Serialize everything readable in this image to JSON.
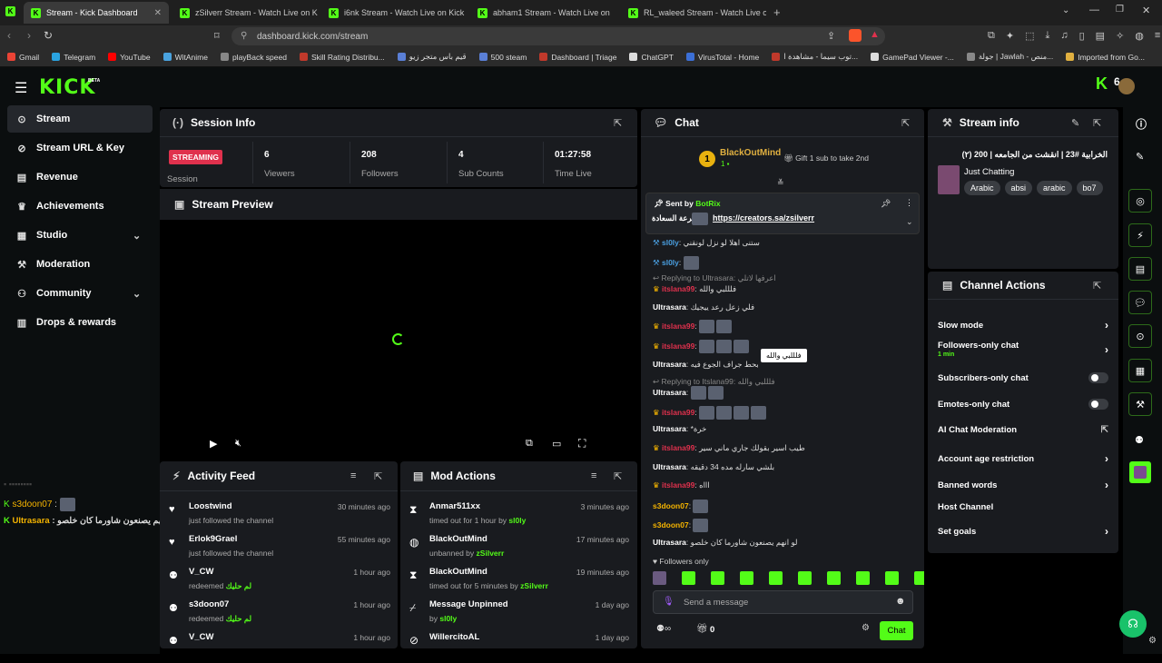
{
  "browser": {
    "tabs": [
      {
        "label": "Stream - Kick Dashboard"
      },
      {
        "label": "zSilverr Stream - Watch Live on Kick"
      },
      {
        "label": "i6nk Stream - Watch Live on Kick"
      },
      {
        "label": "abham1 Stream - Watch Live on"
      },
      {
        "label": "RL_waleed Stream - Watch Live on Ki"
      }
    ],
    "url": "dashboard.kick.com/stream",
    "bookmarks": [
      {
        "label": "Gmail",
        "color": "#ea4335"
      },
      {
        "label": "Telegram",
        "color": "#2aa3e0"
      },
      {
        "label": "YouTube",
        "color": "#ff0000"
      },
      {
        "label": "WitAnime",
        "color": "#4aa3df"
      },
      {
        "label": "playBack speed",
        "color": "#888888"
      },
      {
        "label": "Skill Rating Distribu...",
        "color": "#c0392b"
      },
      {
        "label": "قيم باس متجر زيو",
        "color": "#5a7fd6"
      },
      {
        "label": "500 steam",
        "color": "#5a7fd6"
      },
      {
        "label": "Dashboard | Triage",
        "color": "#c0392b"
      },
      {
        "label": "ChatGPT",
        "color": "#dddddd"
      },
      {
        "label": "VirusTotal - Home",
        "color": "#3b6fd6"
      },
      {
        "label": "توب سيما - مشاهدة ا...",
        "color": "#c0392b"
      },
      {
        "label": "GamePad Viewer -...",
        "color": "#dddddd"
      },
      {
        "label": "جولة | Jawlah - منص...",
        "color": "#888888"
      },
      {
        "label": "Imported from Go...",
        "color": "#e0b040"
      }
    ]
  },
  "brand": {
    "logo": "KICK",
    "badge": "BETA",
    "accent": "#53fc18",
    "avatar_count": "6"
  },
  "sidebar": {
    "items": [
      {
        "label": "Stream",
        "icon": "broadcast-icon"
      },
      {
        "label": "Stream URL & Key",
        "icon": "link-icon"
      },
      {
        "label": "Revenue",
        "icon": "chart-icon"
      },
      {
        "label": "Achievements",
        "icon": "trophy-icon"
      },
      {
        "label": "Studio",
        "icon": "layout-icon"
      },
      {
        "label": "Moderation",
        "icon": "wrench-icon"
      },
      {
        "label": "Community",
        "icon": "community-icon"
      },
      {
        "label": "Drops & rewards",
        "icon": "gift-icon"
      }
    ]
  },
  "session": {
    "title": "Session Info",
    "badge": "STREAMING",
    "badge_label": "Session",
    "stats": [
      {
        "value": "6",
        "label": "Viewers"
      },
      {
        "value": "208",
        "label": "Followers"
      },
      {
        "value": "4",
        "label": "Sub Counts"
      },
      {
        "value": "01:27:58",
        "label": "Time Live"
      }
    ]
  },
  "preview": {
    "title": "Stream Preview"
  },
  "activity": {
    "title": "Activity Feed",
    "items": [
      {
        "name": "Loostwind",
        "sub": "just followed the channel",
        "time": "30 minutes ago",
        "accent": ""
      },
      {
        "name": "Erlok9Grael",
        "sub": "just followed the channel",
        "time": "55 minutes ago",
        "accent": ""
      },
      {
        "name": "V_CW",
        "sub": "redeemed",
        "time": "1 hour ago",
        "accent": "لم حليك"
      },
      {
        "name": "s3doon07",
        "sub": "redeemed",
        "time": "1 hour ago",
        "accent": "لم حليك"
      },
      {
        "name": "V_CW",
        "sub": "",
        "time": "1 hour ago",
        "accent": ""
      }
    ]
  },
  "mod": {
    "title": "Mod Actions",
    "items": [
      {
        "name": "Anmar511xx",
        "sub": "timed out for 1 hour by",
        "by": "sl0ly",
        "time": "3 minutes ago"
      },
      {
        "name": "BlackOutMind",
        "sub": "unbanned by",
        "by": "zSilverr",
        "time": "17 minutes ago"
      },
      {
        "name": "BlackOutMind",
        "sub": "timed out for 5 minutes by",
        "by": "zSilverr",
        "time": "19 minutes ago"
      },
      {
        "name": "Message Unpinned",
        "sub": "by",
        "by": "sl0ly",
        "time": "1 day ago"
      },
      {
        "name": "WillercitoAL",
        "sub": "",
        "by": "",
        "time": "1 day ago"
      }
    ]
  },
  "chat": {
    "title": "Chat",
    "top_gifter": "BlackOutMind",
    "top_gifter_count": "1",
    "gift_text": "Gift 1 sub to take 2nd",
    "pinned_sender_label": "Sent by",
    "pinned_sender": "BotRix",
    "pinned_text": "جرعة السعادة",
    "pinned_link": "https://creators.sa/zsilverr",
    "tooltip": "فلللبي والله",
    "followers_only": "Followers only",
    "placeholder": "Send a message",
    "count": "0",
    "send": "Chat",
    "lines": [
      {
        "user": "sl0ly",
        "text": "ستنى اهلا لو نزل لونقني"
      },
      {
        "user": "sl0ly",
        "text": ""
      },
      {
        "user": "",
        "text": "Replying to Ultrasara: اعرفها لاتلي"
      },
      {
        "user": "itslana99",
        "text": "فلللبي والله"
      },
      {
        "user": "Ultrasara",
        "text": "فلي زعل رعد ييجيك"
      },
      {
        "user": "itslana99",
        "text": ""
      },
      {
        "user": "itslana99",
        "text": ""
      },
      {
        "user": "Ultrasara",
        "text": "بحط جراف الجوع فيه"
      },
      {
        "user": "",
        "text": "Replying to Itslana99: فلللبي والله"
      },
      {
        "user": "Ultrasara",
        "text": ""
      },
      {
        "user": "itslana99",
        "text": ""
      },
      {
        "user": "Ultrasara",
        "text": "*خرة"
      },
      {
        "user": "itslana99",
        "text": "طيب اسير بقولك جاري ماني سير"
      },
      {
        "user": "Ultrasara",
        "text": "بلشي سارله مده 34 دقيقه"
      },
      {
        "user": "itslana99",
        "text": "اااه"
      },
      {
        "user": "s3doon07",
        "text": ""
      },
      {
        "user": "s3doon07",
        "text": ""
      },
      {
        "user": "Ultrasara",
        "text": "لو انهم يصنعون شاورما كان خلصو"
      }
    ]
  },
  "overlay": {
    "lines": [
      {
        "user": "s3doon07",
        "text": ""
      },
      {
        "user": "Ultrasara",
        "text": "لو انهم يصنعون شاورما كان خلصو"
      }
    ]
  },
  "stream_info": {
    "title": "Stream info",
    "stream_title": "الخرابية #23 | انقشت من الجامعه | 200 (٢)",
    "category": "Just Chatting",
    "tags": [
      "Arabic",
      "absi",
      "arabic",
      "bo7"
    ]
  },
  "channel_actions": {
    "title": "Channel Actions",
    "items": [
      {
        "label": "Slow mode",
        "control": "chevron"
      },
      {
        "label": "Followers-only chat",
        "sub": "1 min",
        "control": "chevron"
      },
      {
        "label": "Subscribers-only chat",
        "control": "toggle"
      },
      {
        "label": "Emotes-only chat",
        "control": "toggle"
      },
      {
        "label": "AI Chat Moderation",
        "control": "external"
      },
      {
        "label": "Account age restriction",
        "control": "chevron"
      },
      {
        "label": "Banned words",
        "control": "chevron"
      },
      {
        "label": "Host Channel",
        "control": ""
      },
      {
        "label": "Set goals",
        "control": "chevron"
      }
    ]
  }
}
